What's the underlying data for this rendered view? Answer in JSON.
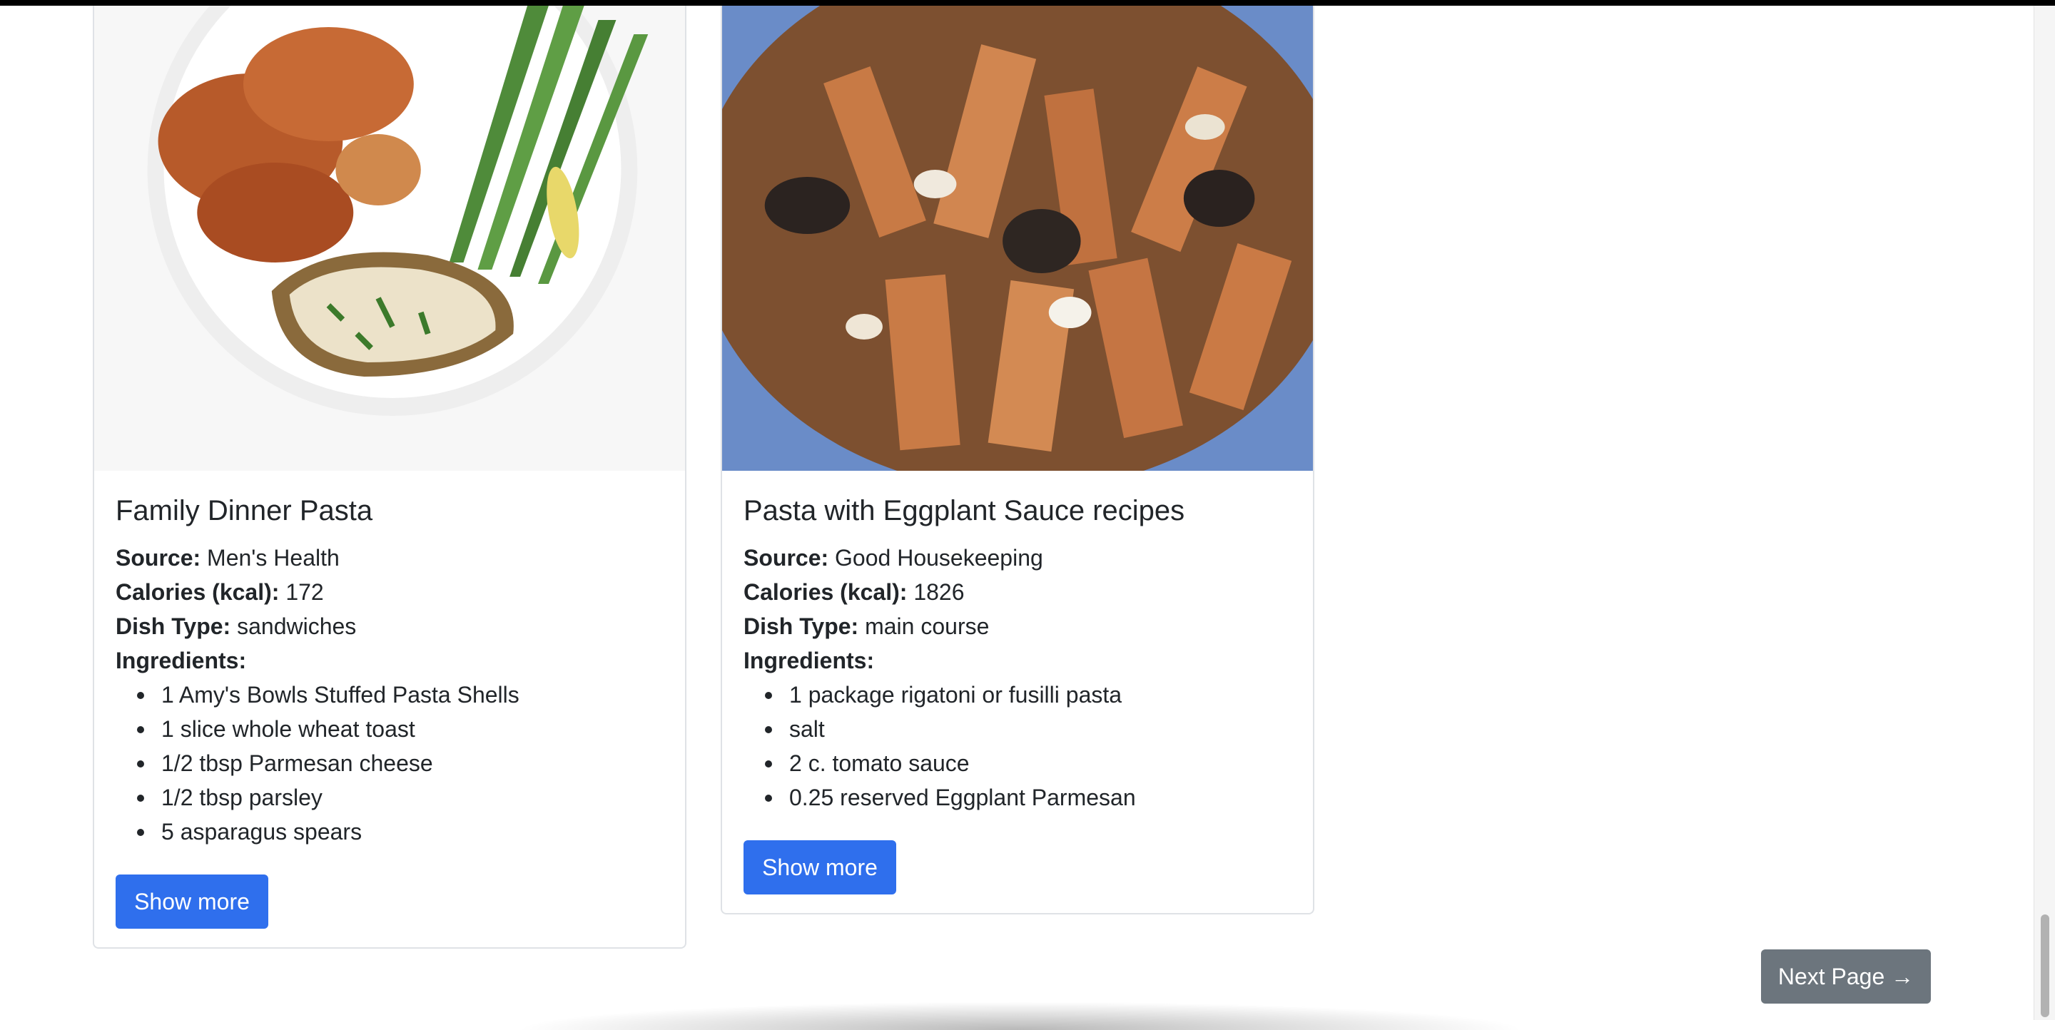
{
  "recipes": [
    {
      "title": "Family Dinner Pasta",
      "source_label": "Source:",
      "source": "Men's Health",
      "calories_label": "Calories (kcal):",
      "calories": "172",
      "dish_type_label": "Dish Type:",
      "dish_type": "sandwiches",
      "ingredients_label": "Ingredients:",
      "ingredients": [
        "1 Amy's Bowls Stuffed Pasta Shells",
        "1 slice whole wheat toast",
        "1/2 tbsp Parmesan cheese",
        "1/2 tbsp parsley",
        "5 asparagus spears"
      ],
      "button_label": "Show more"
    },
    {
      "title": "Pasta with Eggplant Sauce recipes",
      "source_label": "Source:",
      "source": "Good Housekeeping",
      "calories_label": "Calories (kcal):",
      "calories": "1826",
      "dish_type_label": "Dish Type:",
      "dish_type": "main course",
      "ingredients_label": "Ingredients:",
      "ingredients": [
        "1 package rigatoni or fusilli pasta",
        "salt",
        "2 c. tomato sauce",
        "0.25 reserved Eggplant Parmesan"
      ],
      "button_label": "Show more"
    }
  ],
  "pagination": {
    "next_label": "Next Page →"
  },
  "colors": {
    "primary": "#2f6fed",
    "secondary": "#6c757d",
    "border": "#dfe2e6",
    "text": "#212529"
  }
}
